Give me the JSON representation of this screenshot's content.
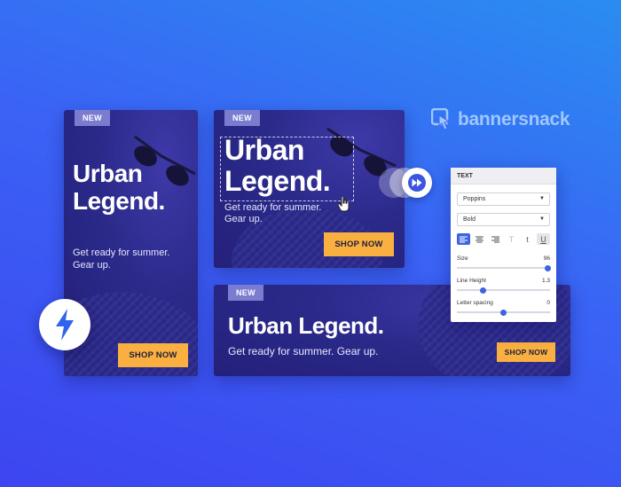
{
  "brand": {
    "name": "bannersnack",
    "color": "#9fc7ff"
  },
  "accent": "#f9b040",
  "banners": {
    "tall": {
      "badge": "NEW",
      "headline_line1": "Urban",
      "headline_line2": "Legend.",
      "sub_line1": "Get ready for summer.",
      "sub_line2": "Gear up.",
      "cta": "SHOP NOW"
    },
    "square": {
      "badge": "NEW",
      "headline_line1": "Urban",
      "headline_line2": "Legend.",
      "sub_line1": "Get ready for summer.",
      "sub_line2": "Gear up.",
      "cta": "SHOP NOW"
    },
    "wide": {
      "badge": "NEW",
      "headline": "Urban Legend.",
      "sub": "Get ready for summer. Gear up.",
      "cta": "SHOP NOW"
    }
  },
  "text_panel": {
    "title": "TEXT",
    "font": "Poppins",
    "weight": "Bold",
    "tools": [
      "align-left-icon",
      "align-center-icon",
      "align-right-icon",
      "text-fade-icon",
      "text-case-icon",
      "underline-icon"
    ],
    "size_label": "Size",
    "size_value": "96",
    "size_fraction": 0.98,
    "line_height_label": "Line Height",
    "line_height_value": "1.3",
    "line_height_fraction": 0.28,
    "letter_spacing_label": "Letter spacing",
    "letter_spacing_value": "0",
    "letter_spacing_fraction": 0.5
  },
  "icons": [
    "lightning-icon",
    "fast-forward-icon",
    "hand-cursor-icon",
    "bannersnack-logo-icon"
  ]
}
